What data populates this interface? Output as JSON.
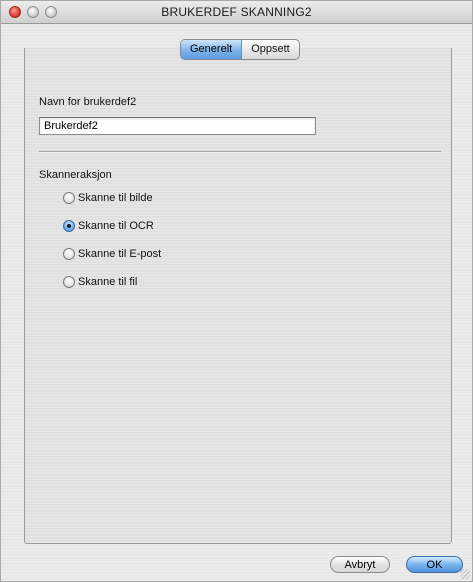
{
  "window": {
    "title": "BRUKERDEF SKANNING2"
  },
  "tabs": [
    {
      "label": "Generelt",
      "active": true
    },
    {
      "label": "Oppsett",
      "active": false
    }
  ],
  "name_field": {
    "label": "Navn for brukerdef2",
    "value": "Brukerdef2"
  },
  "scan_action": {
    "label": "Skanneraksjon",
    "options": [
      {
        "label": "Skanne til bilde",
        "checked": false
      },
      {
        "label": "Skanne til OCR",
        "checked": true
      },
      {
        "label": "Skanne til E-post",
        "checked": false
      },
      {
        "label": "Skanne til fil",
        "checked": false
      }
    ]
  },
  "buttons": {
    "cancel": "Avbryt",
    "ok": "OK"
  },
  "colors": {
    "accent": "#5b9be0",
    "close": "#d8312a"
  }
}
